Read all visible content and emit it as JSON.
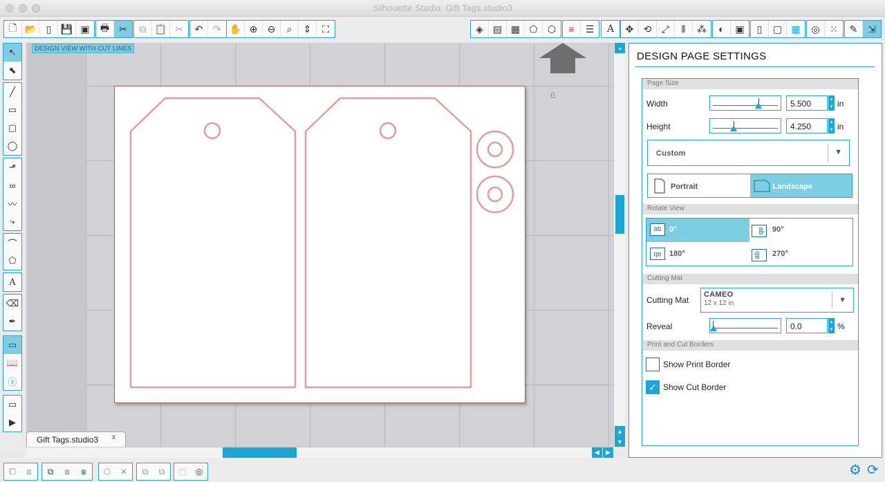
{
  "window": {
    "title": "Silhouette Studio: Gift Tags.studio3"
  },
  "canvas": {
    "view_label": "DESIGN VIEW WITH CUT LINES",
    "page_number": "6",
    "doc_tab": "Gift Tags.studio3",
    "doc_tab_close": "x"
  },
  "panel": {
    "title": "DESIGN PAGE SETTINGS",
    "page_size": {
      "header": "Page Size",
      "width_label": "Width",
      "width_value": "5.500",
      "height_label": "Height",
      "height_value": "4.250",
      "unit": "in",
      "preset": "Custom",
      "portrait": "Portrait",
      "landscape": "Landscape",
      "selected_orientation": "landscape"
    },
    "rotate_view": {
      "header": "Rotate View",
      "options": [
        "0°",
        "90°",
        "180°",
        "270°"
      ],
      "selected": "0°"
    },
    "cutting_mat": {
      "header": "Cutting Mat",
      "label": "Cutting Mat",
      "value_name": "CAMEO",
      "value_size": "12 x 12 in",
      "reveal_label": "Reveal",
      "reveal_value": "0.0",
      "reveal_unit": "%"
    },
    "borders": {
      "header": "Print and Cut Borders",
      "show_print_border": "Show Print Border",
      "show_cut_border": "Show Cut Border",
      "print_border_checked": false,
      "cut_border_checked": true
    }
  },
  "colors": {
    "accent": "#1aa7d6",
    "cut_line": "#e79a9a",
    "selected": "#7dcde4"
  }
}
